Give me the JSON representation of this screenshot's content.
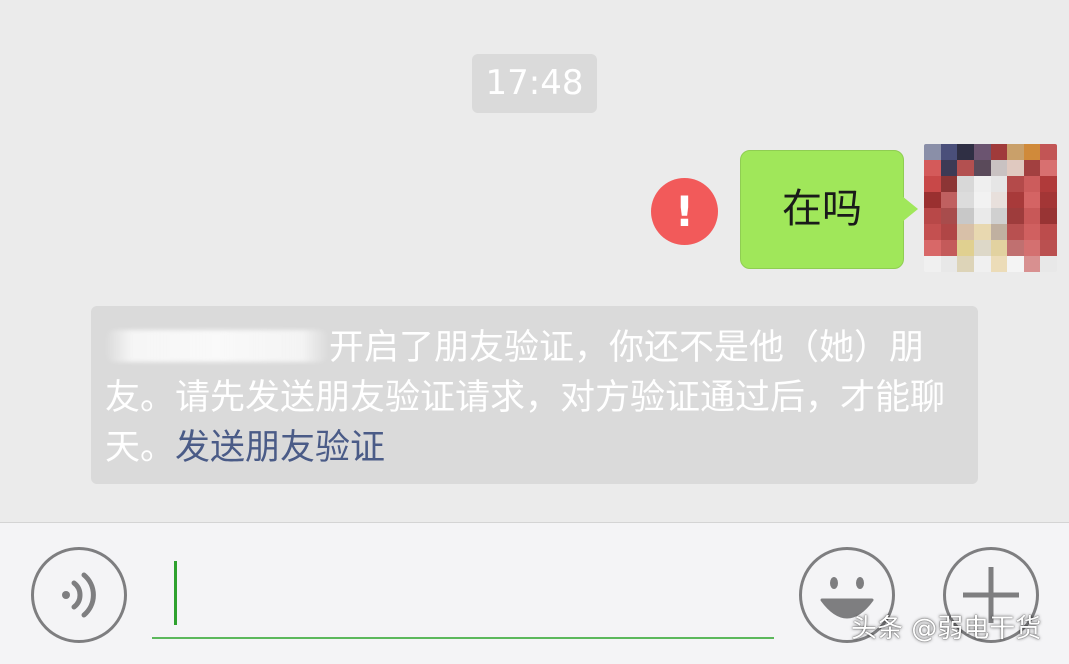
{
  "chat": {
    "timestamp": "17:48",
    "sent_message": {
      "text": "在吗",
      "status_icon": "exclamation-icon",
      "bubble_color": "#a0e75a",
      "error_color": "#f25a5a"
    },
    "avatar_icon": "pixelated-avatar",
    "system_notice": {
      "text": "开启了朋友验证，你还不是他（她）朋友。请先发送朋友验证请求，对方验证通过后，才能聊天。",
      "link_text": "发送朋友验证",
      "link_color": "#4a5b87"
    }
  },
  "input_bar": {
    "voice_icon": "voice-icon",
    "emoji_icon": "smiley-icon",
    "more_icon": "plus-icon",
    "text_value": ""
  },
  "watermark": "头条 @弱电干货"
}
